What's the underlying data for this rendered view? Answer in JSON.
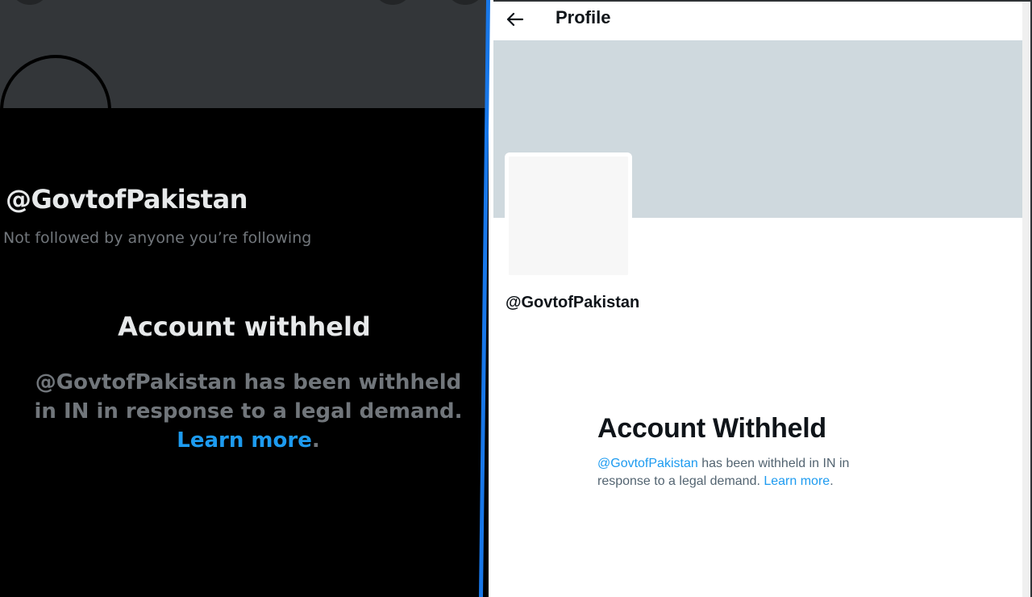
{
  "mobile_view": {
    "handle": "@GovtofPakistan",
    "followed_text": "Not followed by anyone you’re following",
    "withheld_title": "Account withheld",
    "withheld_message": "@GovtofPakistan has been withheld in IN in response to a legal demand.",
    "learn_more": "Learn more",
    "trailing_period": "."
  },
  "web_view": {
    "header_title": "Profile",
    "handle": "@GovtofPakistan",
    "withheld_title": "Account Withheld",
    "withheld_handle_link": "@GovtofPakistan",
    "withheld_message": " has been withheld in IN in response to a legal demand. ",
    "learn_more": "Learn more",
    "trailing_period": "."
  },
  "colors": {
    "link_blue": "#1d9bf0",
    "banner_dark": "#333639",
    "banner_light": "#cfd9de",
    "divider_blue": "#1877e8"
  },
  "icons": {
    "back": "left-arrow-icon"
  }
}
